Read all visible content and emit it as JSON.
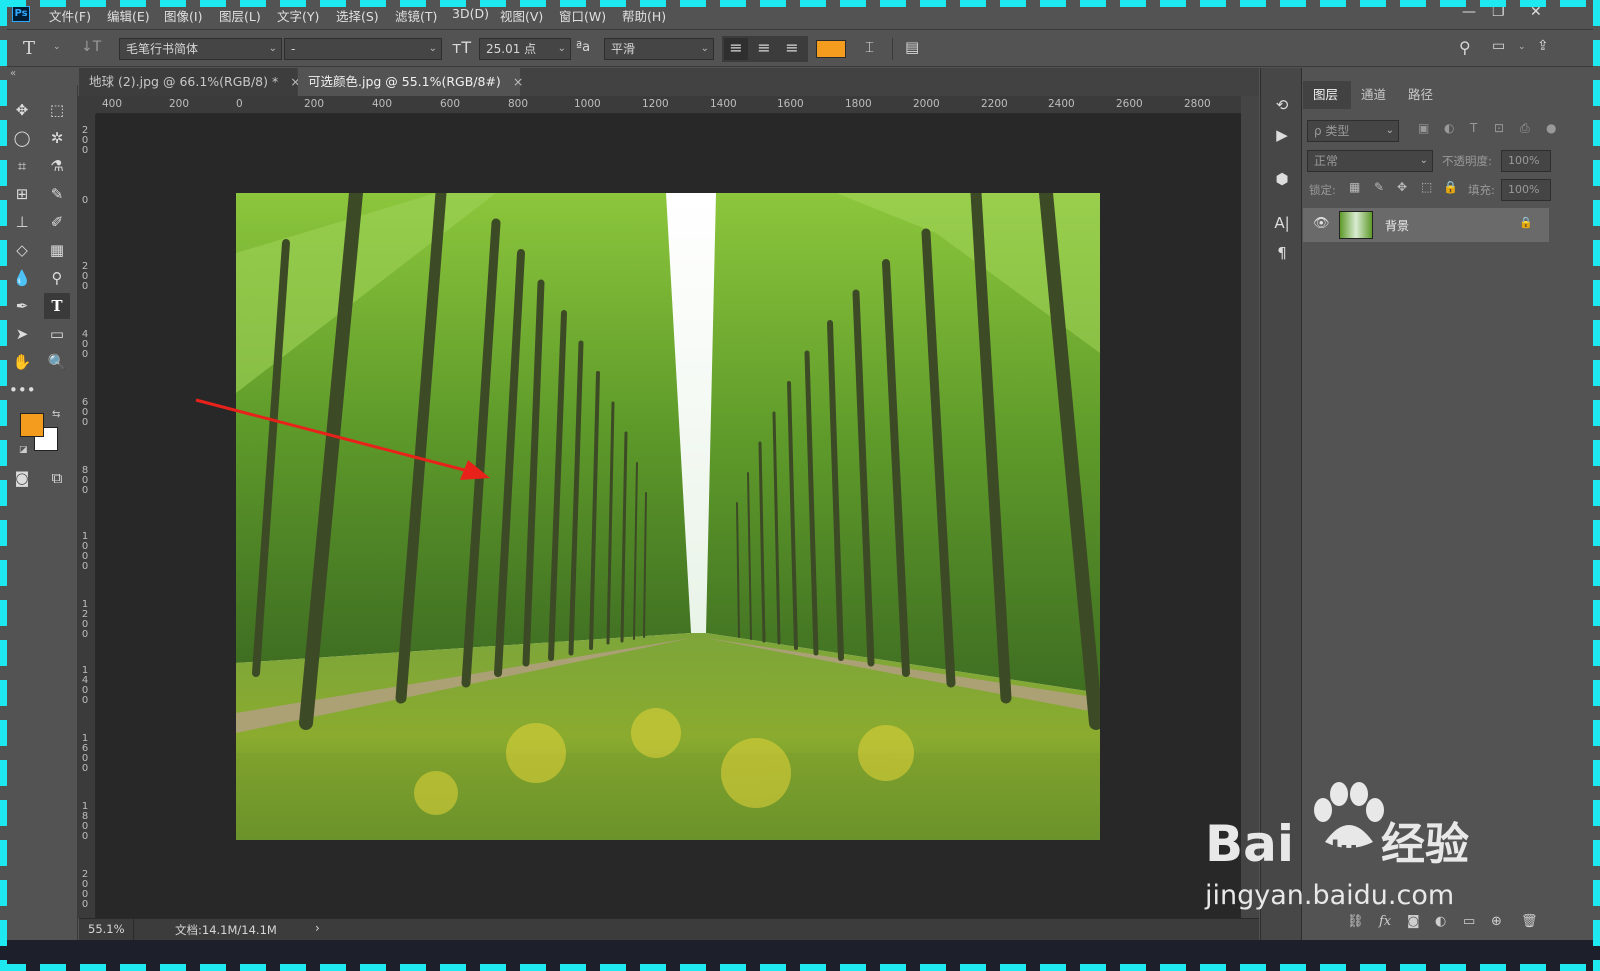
{
  "menu": {
    "logo": "Ps",
    "items": [
      "文件(F)",
      "编辑(E)",
      "图像(I)",
      "图层(L)",
      "文字(Y)",
      "选择(S)",
      "滤镜(T)",
      "3D(D)",
      "视图(V)",
      "窗口(W)",
      "帮助(H)"
    ]
  },
  "options": {
    "font_family": "毛笔行书简体",
    "font_style": "-",
    "font_size": "25.01 点",
    "aa_label": "ªa",
    "antialias": "平滑",
    "text_color": "#f39c1e"
  },
  "tabs": [
    {
      "label": "地球 (2).jpg @ 66.1%(RGB/8) *",
      "close": "×"
    },
    {
      "label": "可选颜色.jpg @ 55.1%(RGB/8#)",
      "close": "×"
    }
  ],
  "ruler": {
    "h_ticks": [
      "400",
      "200",
      "0",
      "200",
      "400",
      "600",
      "800",
      "1000",
      "1200",
      "1400",
      "1600",
      "1800",
      "2000",
      "2200",
      "2400",
      "2600",
      "2800"
    ],
    "v_ticks": [
      "200",
      "0",
      "200",
      "400",
      "600",
      "800",
      "1000",
      "1200",
      "1400",
      "1600",
      "1800",
      "2000"
    ]
  },
  "status": {
    "zoom": "55.1%",
    "doc": "文档:14.1M/14.1M",
    "arrow": "›"
  },
  "colors": {
    "foreground": "#f39c1e",
    "background": "#ffffff",
    "arrow": "#e8221a"
  },
  "layers": {
    "tabs": [
      "图层",
      "通道",
      "路径"
    ],
    "filter_kind": "ρ 类型",
    "blend_mode": "正常",
    "opacity_label": "不透明度:",
    "opacity": "100%",
    "lock_label": "锁定:",
    "fill_label": "填充:",
    "fill": "100%",
    "layer_name": "背景"
  },
  "watermark": {
    "brand": "Bai",
    "du": "du",
    "cn": "经验",
    "url": "jingyan.baidu.com"
  }
}
